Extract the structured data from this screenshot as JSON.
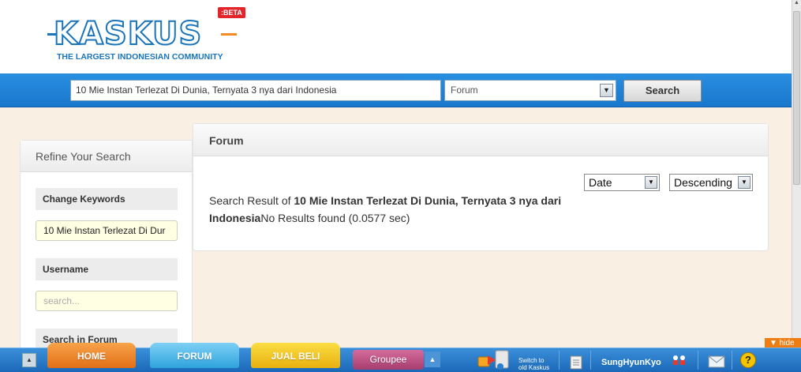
{
  "brand": {
    "logo_text": "KASKUS",
    "beta_badge": ":BETA",
    "tagline": "THE LARGEST INDONESIAN COMMUNITY"
  },
  "search": {
    "keywords_value": "10 Mie Instan Terlezat Di Dunia, Ternyata 3 nya dari Indonesia",
    "category_value": "Forum",
    "button_label": "Search"
  },
  "sidebar": {
    "title": "Refine Your Search",
    "change_keywords_label": "Change Keywords",
    "keywords_value": "10 Mie Instan Terlezat Di Dur",
    "username_label": "Username",
    "username_placeholder": "search...",
    "search_in_forum_label": "Search in Forum"
  },
  "main": {
    "title": "Forum",
    "sort_by_value": "Date",
    "order_value": "Descending",
    "result_prefix": "Search Result of ",
    "result_query": "10 Mie Instan Terlezat Di Dunia, Ternyata 3 nya dari Indonesia",
    "result_status": "No Results found (0.0577 sec)"
  },
  "bottom_bar": {
    "tabs": [
      {
        "label": "HOME",
        "color": "#e8761b"
      },
      {
        "label": "FORUM",
        "color": "#35a8de"
      },
      {
        "label": "JUAL BELI",
        "color": "#eeb816"
      },
      {
        "label": "Groupee",
        "color": "#b24776"
      }
    ],
    "switch_text_line1": "Switch to",
    "switch_text_line2": "old Kaskus",
    "username": "SungHyunKyo",
    "hide_label": "▼ hide"
  },
  "colors": {
    "header_blue": "#1a75bb",
    "accent_orange": "#f28b24",
    "page_bg": "#f9f0e3"
  }
}
